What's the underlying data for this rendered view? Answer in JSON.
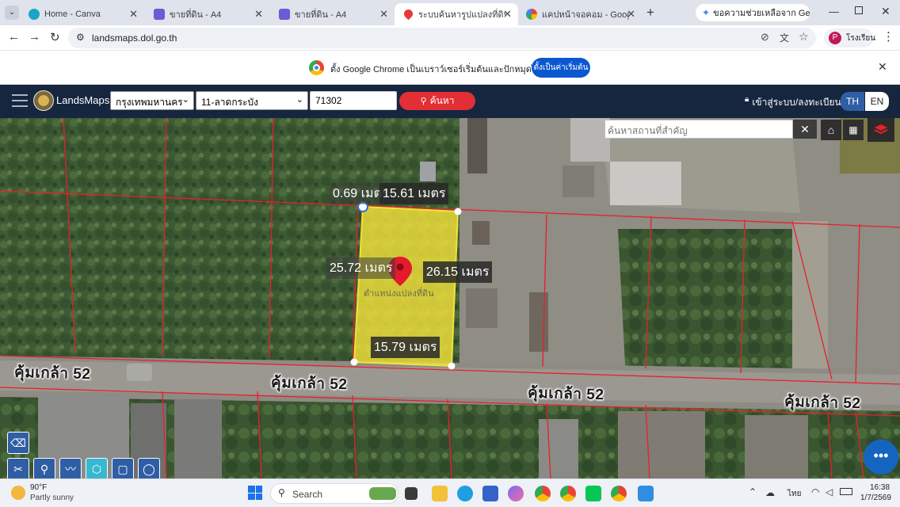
{
  "browser": {
    "tabs": [
      {
        "label": "Home - Canva",
        "color": "#1aa4c9"
      },
      {
        "label": "ขายที่ดิน - A4",
        "color": "#6b5bd6"
      },
      {
        "label": "ขายที่ดิน - A4",
        "color": "#6b5bd6"
      },
      {
        "label": "ระบบค้นหารูปแปลงที่ดิน (Lands",
        "color": "#e53935"
      },
      {
        "label": "แคปหน้าจอคอม - Google Se",
        "color": "#4285f4"
      }
    ],
    "gemini_label": "ขอความช่วยเหลือจาก Gemini",
    "url": "landsmaps.dol.go.th",
    "profile_initial": "P",
    "profile_label": "โรงเรียน"
  },
  "infobar": {
    "message": "ตั้ง Google Chrome เป็นเบราว์เซอร์เริ่มต้นและปักหมุดไว้ที่แถบงาน",
    "button_label": "ตั้งเป็นค่าเริ่มต้น"
  },
  "landsmaps": {
    "brand": "LandsMaps",
    "province": "กรุงเทพมหานคร",
    "district": "11-ลาดกระบัง",
    "parcel_no": "71302",
    "search_label": "ค้นหา",
    "login_label": "เข้าสู่ระบบ/ลงทะเบียน",
    "lang_th": "TH",
    "lang_en": "EN",
    "place_search_placeholder": "ค้นหาสถานที่สำคัญ"
  },
  "map": {
    "dim_top_left": "0.69 เมตร",
    "dim_top": "15.61 เมตร",
    "dim_left": "25.72 เมตร",
    "dim_right": "26.15 เมตร",
    "dim_bottom": "15.79 เมตร",
    "parcel_label": "ตำแหน่งแปลงที่ดิน",
    "road_1": "คุ้มเกล้า 52",
    "road_2": "คุ้มเกล้า 52",
    "road_3": "คุ้มเกล้า 52",
    "road_4": "คุ้มเกล้า 52",
    "colors": {
      "parcel_fill": "#f2e23a",
      "boundary": "#e8202a"
    }
  },
  "taskbar": {
    "weather_temp": "90°F",
    "weather_desc": "Partly sunny",
    "search_label": "Search",
    "lang": "ไทย",
    "time": "16:38",
    "date": "1/7/2569"
  }
}
